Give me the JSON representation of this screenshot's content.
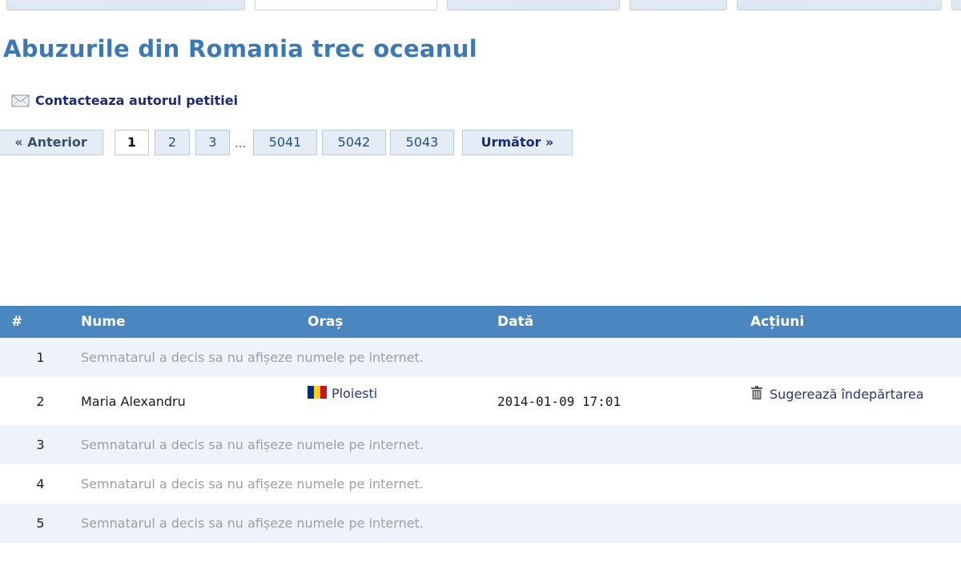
{
  "title": "Abuzurile din Romania trec oceanul",
  "contact": {
    "label": "Contacteaza autorul petitiei",
    "icon": "envelope-icon"
  },
  "pager": {
    "prev_label": "« Anterior",
    "pages": [
      "1",
      "2",
      "3"
    ],
    "ellipsis": "...",
    "last_pages": [
      "5041",
      "5042",
      "5043"
    ],
    "next_label": "Următor »",
    "current": "1"
  },
  "table": {
    "headers": {
      "num": "#",
      "name": "Nume",
      "city": "Oraș",
      "date": "Dată",
      "actions": "Acțiuni"
    },
    "rows": [
      {
        "num": "1",
        "name": "Semnatarul a decis sa nu afișeze numele pe internet.",
        "hidden": true,
        "city": "",
        "date": "",
        "action": ""
      },
      {
        "num": "2",
        "name": "Maria Alexandru",
        "hidden": false,
        "city": "Ploiesti",
        "date": "2014-01-09 17:01",
        "action": "Sugerează îndepărtarea"
      },
      {
        "num": "3",
        "name": "Semnatarul a decis sa nu afișeze numele pe internet.",
        "hidden": true,
        "city": "",
        "date": "",
        "action": ""
      },
      {
        "num": "4",
        "name": "Semnatarul a decis sa nu afișeze numele pe internet.",
        "hidden": true,
        "city": "",
        "date": "",
        "action": ""
      },
      {
        "num": "5",
        "name": "Semnatarul a decis sa nu afișeze numele pe internet.",
        "hidden": true,
        "city": "",
        "date": "",
        "action": ""
      }
    ]
  },
  "colors": {
    "title": "#3a78b8",
    "header_bg": "#4a86c0",
    "link": "#1c2a7a",
    "flag_blue": "#002b7f",
    "flag_yellow": "#fcd116",
    "flag_red": "#ce1126"
  }
}
